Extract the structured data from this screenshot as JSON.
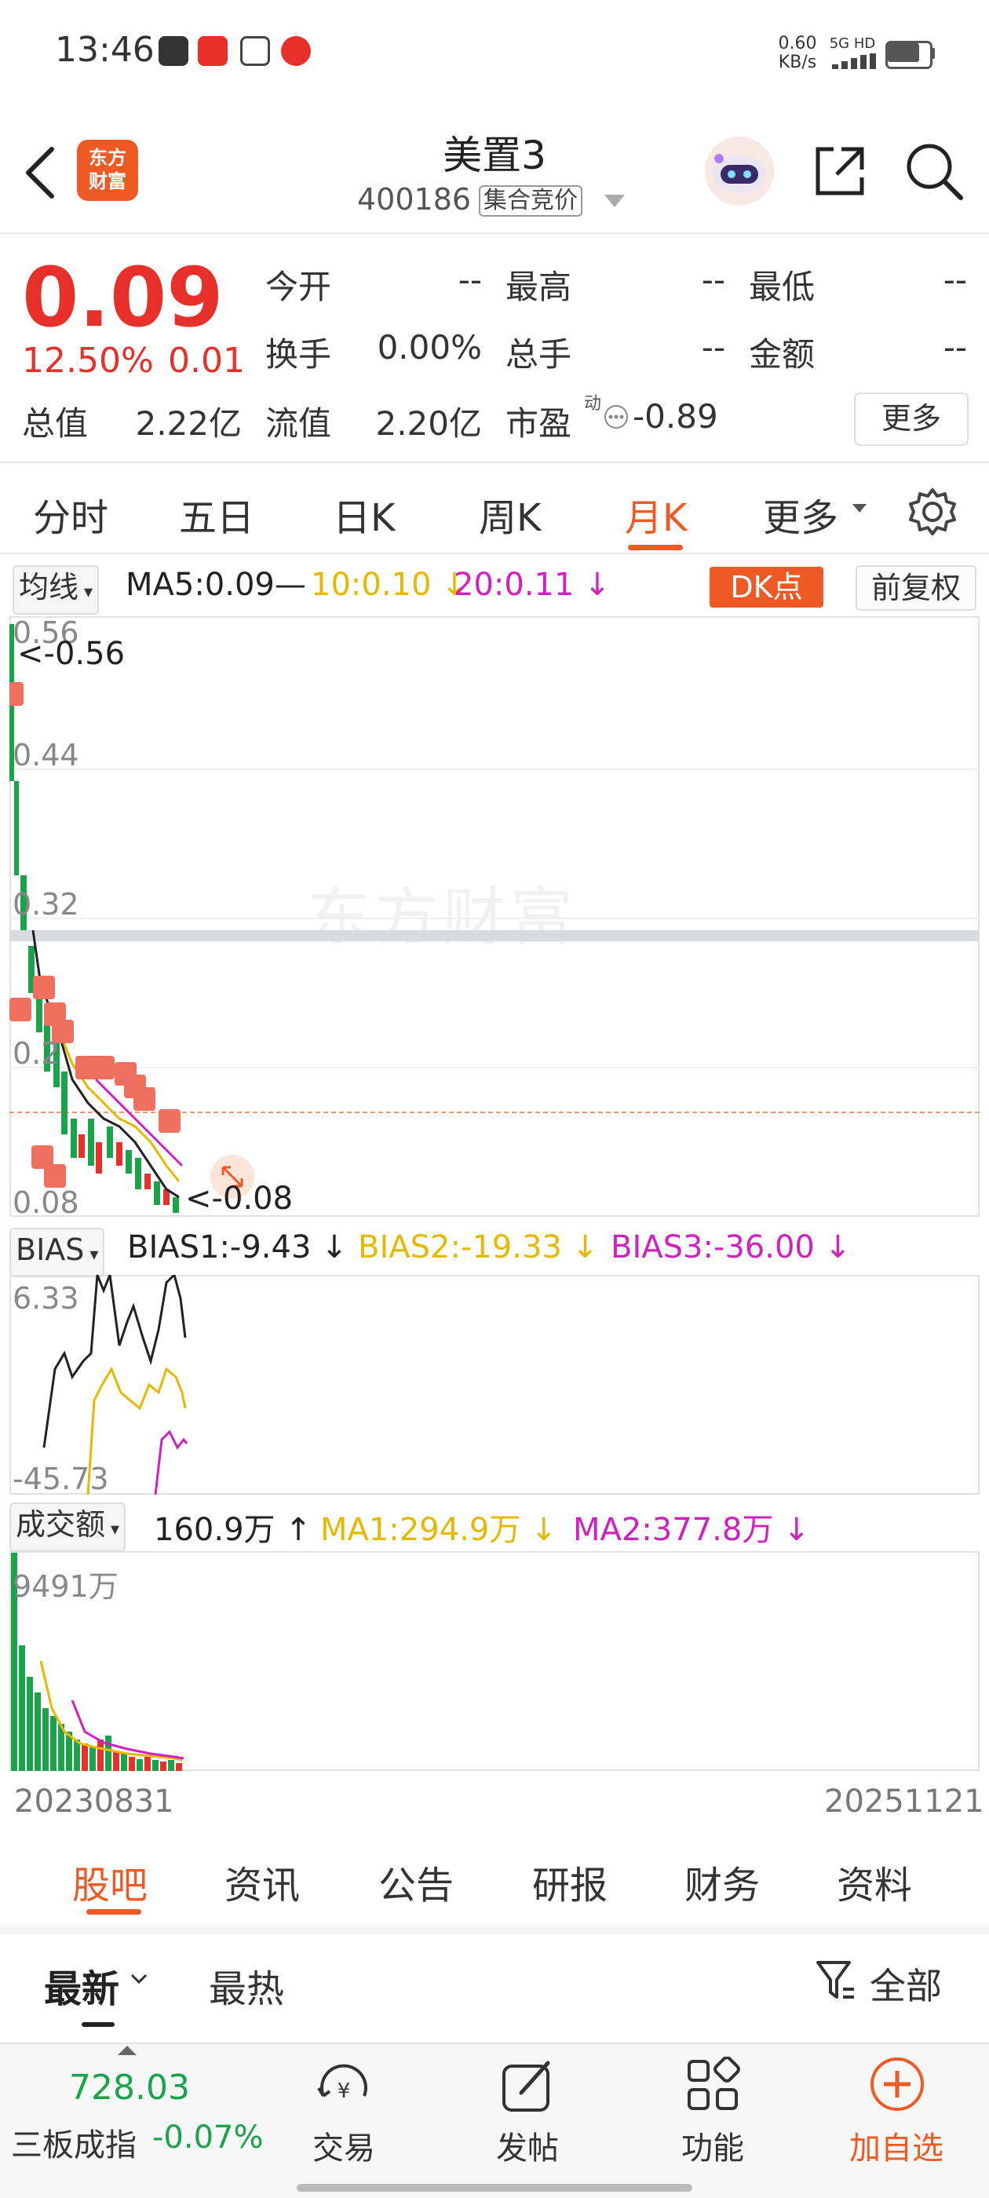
{
  "status_bar": {
    "time": "13:46",
    "net_speed_value": "0.60",
    "net_speed_unit": "KB/s",
    "network": "5G HD",
    "icons": [
      "app-icon",
      "toutiao-icon",
      "wallet-icon",
      "gift-icon",
      "signal-icon",
      "battery-icon"
    ]
  },
  "header": {
    "logo_text_line1": "东方",
    "logo_text_line2": "财富",
    "title": "美置3",
    "code": "400186",
    "badge": "集合竞价"
  },
  "quote": {
    "price": "0.09",
    "change_pct": "12.50%",
    "change_amt": "0.01",
    "total_value_label": "总值",
    "total_value": "2.22亿",
    "open_label": "今开",
    "open": "--",
    "high_label": "最高",
    "high": "--",
    "low_label": "最低",
    "low": "--",
    "turnover_label": "换手",
    "turnover": "0.00%",
    "total_hand_label": "总手",
    "total_hand": "--",
    "amount_label": "金额",
    "amount": "--",
    "float_value_label": "流值",
    "float_value": "2.20亿",
    "pe_label": "市盈",
    "pe_sup": "动",
    "pe": "-0.89",
    "more": "更多"
  },
  "period_tabs": [
    "分时",
    "五日",
    "日K",
    "周K",
    "月K",
    "更多"
  ],
  "active_tab": "月K",
  "main_chart": {
    "indicator_select": "均线",
    "ma5": "MA5:0.09—",
    "ma10": "10:0.10 ↓",
    "ma20": "20:0.11 ↓",
    "dk_button": "DK点",
    "adjust_button": "前复权",
    "watermark": "东方财富",
    "y_labels": [
      "0.56",
      "0.44",
      "0.32",
      "0.2",
      "0.08"
    ],
    "max_marker": "<-0.56",
    "min_marker": "<-0.08",
    "buy_marker": "B"
  },
  "bias_chart": {
    "select": "BIAS",
    "bias1": "BIAS1:-9.43 ↓",
    "bias2": "BIAS2:-19.33 ↓",
    "bias3": "BIAS3:-36.00 ↓",
    "y_top": "6.33",
    "y_bottom": "-45.73"
  },
  "volume_chart": {
    "select": "成交额",
    "value": "160.9万 ↑",
    "ma1": "MA1:294.9万 ↓",
    "ma2": "MA2:377.8万 ↓",
    "y_top": "9491万"
  },
  "date_range": {
    "start": "20230831",
    "end": "20251121"
  },
  "bottom_tabs": [
    "股吧",
    "资讯",
    "公告",
    "研报",
    "财务",
    "资料"
  ],
  "active_bottom_tab": "股吧",
  "sort_row": {
    "latest": "最新",
    "hot": "最热",
    "filter": "全部"
  },
  "nav": {
    "index_value": "728.03",
    "index_name": "三板成指",
    "index_change": "-0.07%",
    "trade": "交易",
    "post": "发帖",
    "function": "功能",
    "add_watch": "加自选"
  },
  "colors": {
    "accent": "#ef5a24",
    "up_red": "#e8302a",
    "down_green": "#1aa34a",
    "ma10_yellow": "#e6b800",
    "ma20_magenta": "#d020c0"
  }
}
